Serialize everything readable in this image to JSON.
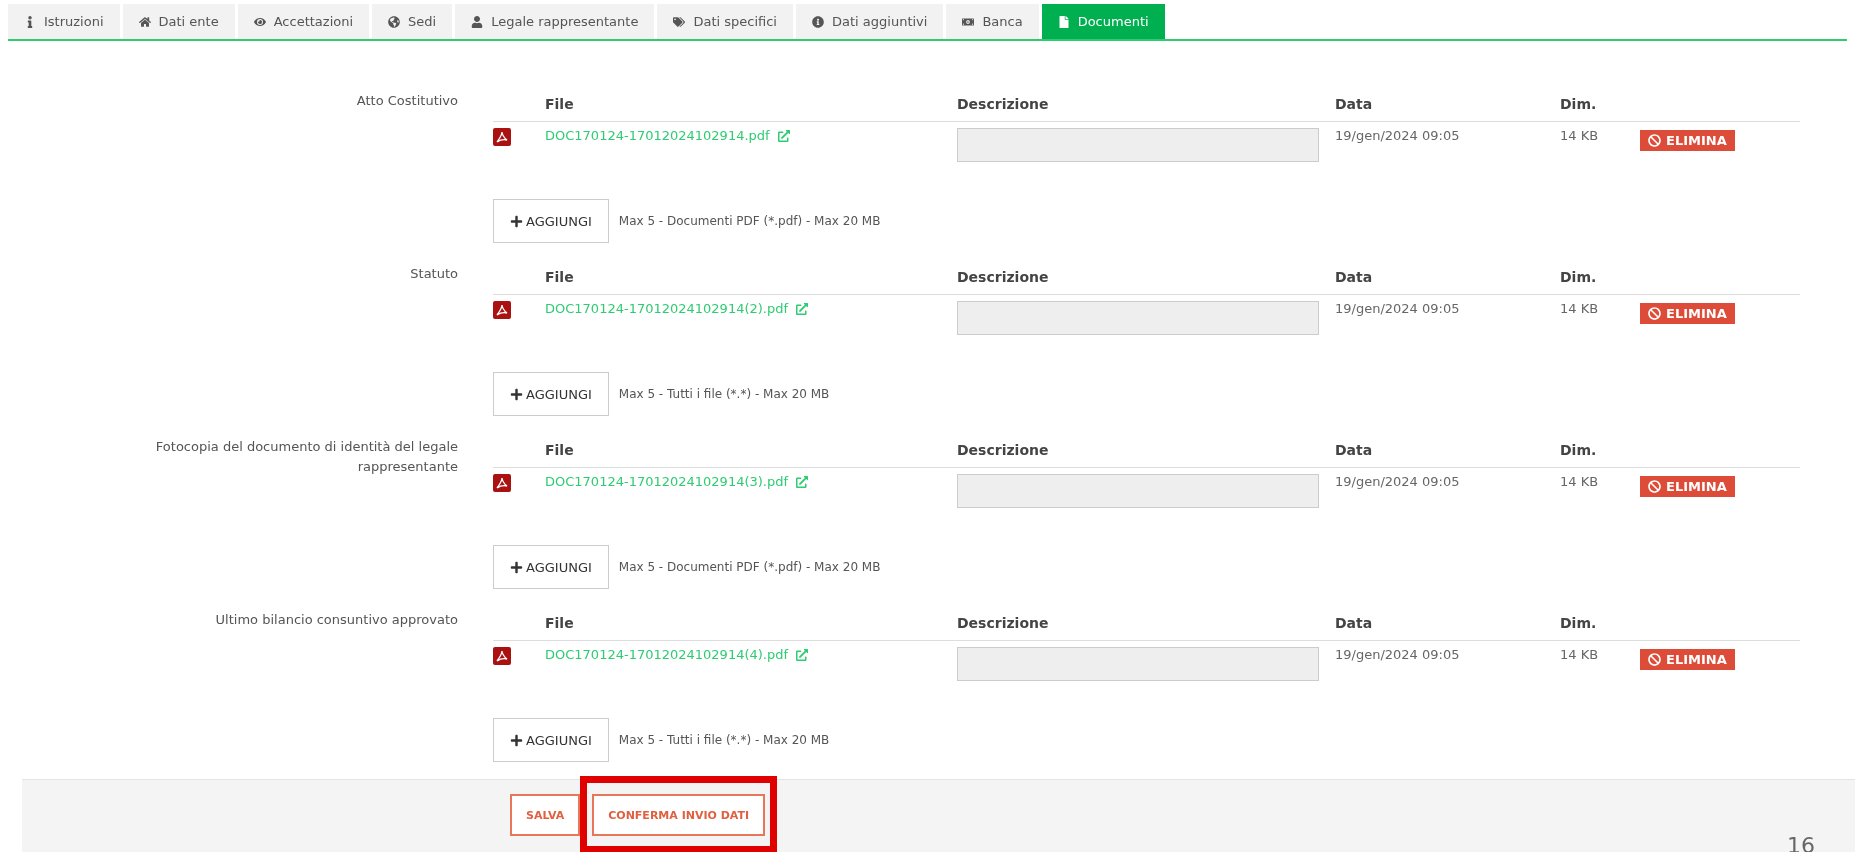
{
  "tabs": [
    {
      "label": "Istruzioni",
      "selected": false
    },
    {
      "label": "Dati ente",
      "selected": false
    },
    {
      "label": "Accettazioni",
      "selected": false
    },
    {
      "label": "Sedi",
      "selected": false
    },
    {
      "label": "Legale rappresentante",
      "selected": false
    },
    {
      "label": "Dati specifici",
      "selected": false
    },
    {
      "label": "Dati aggiuntivi",
      "selected": false
    },
    {
      "label": "Banca",
      "selected": false
    },
    {
      "label": "Documenti",
      "selected": true
    }
  ],
  "sections": [
    {
      "label": "Atto Costitutivo",
      "columns": [
        "File",
        "Descrizione",
        "Data",
        "Dim."
      ],
      "files": [
        {
          "name": "DOC170124-17012024102914.pdf",
          "date": "19/gen/2024 09:05",
          "size": "14 KB",
          "action": "ELIMINA"
        }
      ],
      "add_button": "AGGIUNGI",
      "hint": "Max 5 - Documenti PDF (*.pdf) - Max 20 MB"
    },
    {
      "label": "Statuto",
      "columns": [
        "File",
        "Descrizione",
        "Data",
        "Dim."
      ],
      "files": [
        {
          "name": "DOC170124-17012024102914(2).pdf",
          "date": "19/gen/2024 09:05",
          "size": "14 KB",
          "action": "ELIMINA"
        }
      ],
      "add_button": "AGGIUNGI",
      "hint": "Max 5 - Tutti i file (*.*) - Max 20 MB"
    },
    {
      "label": "Fotocopia del documento di identità del legale rappresentante",
      "columns": [
        "File",
        "Descrizione",
        "Data",
        "Dim."
      ],
      "files": [
        {
          "name": "DOC170124-17012024102914(3).pdf",
          "date": "19/gen/2024 09:05",
          "size": "14 KB",
          "action": "ELIMINA"
        }
      ],
      "add_button": "AGGIUNGI",
      "hint": "Max 5 - Documenti PDF (*.pdf) - Max 20 MB"
    },
    {
      "label": "Ultimo bilancio consuntivo approvato",
      "columns": [
        "File",
        "Descrizione",
        "Data",
        "Dim."
      ],
      "files": [
        {
          "name": "DOC170124-17012024102914(4).pdf",
          "date": "19/gen/2024 09:05",
          "size": "14 KB",
          "action": "ELIMINA"
        }
      ],
      "add_button": "AGGIUNGI",
      "hint": "Max 5 - Tutti i file (*.*) - Max 20 MB"
    }
  ],
  "footer": {
    "buttons": [
      {
        "label": "SALVA",
        "highlighted": false
      },
      {
        "label": "CONFERMA INVIO DATI",
        "highlighted": true
      }
    ],
    "page_number": "16"
  }
}
